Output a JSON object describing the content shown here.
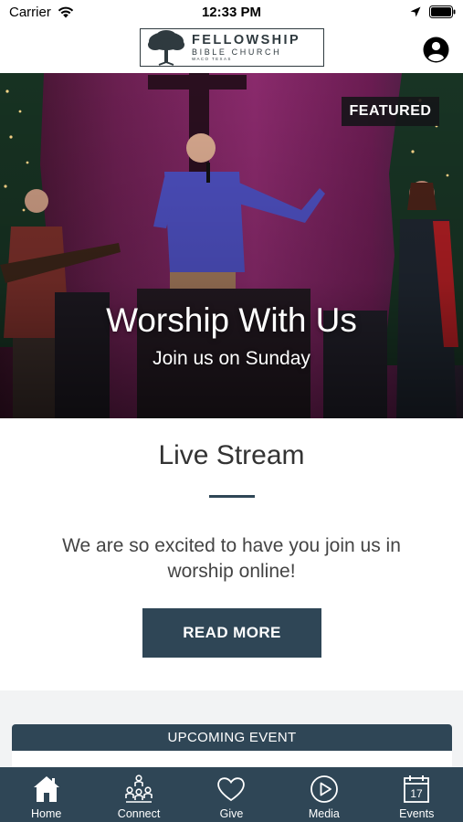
{
  "status_bar": {
    "carrier": "Carrier",
    "time": "12:33 PM"
  },
  "header": {
    "logo": {
      "line1": "FELLOWSHIP",
      "line2": "BIBLE CHURCH",
      "line3": "WACO TEXAS"
    },
    "profile_icon": "person-icon"
  },
  "hero": {
    "badge": "FEATURED",
    "title": "Worship With Us",
    "subtitle": "Join us on Sunday"
  },
  "content": {
    "title": "Live Stream",
    "body": "We are so excited to have you join us in worship online!",
    "button": "READ MORE"
  },
  "event": {
    "header": "UPCOMING EVENT"
  },
  "tabs": [
    {
      "label": "Home",
      "icon": "home-icon"
    },
    {
      "label": "Connect",
      "icon": "people-icon"
    },
    {
      "label": "Give",
      "icon": "heart-icon"
    },
    {
      "label": "Media",
      "icon": "play-icon"
    },
    {
      "label": "Events",
      "icon": "calendar-icon",
      "day": "17"
    }
  ],
  "colors": {
    "primary": "#2f4656",
    "hero_backdrop": "#7a2360",
    "featured_badge": "#141418"
  }
}
